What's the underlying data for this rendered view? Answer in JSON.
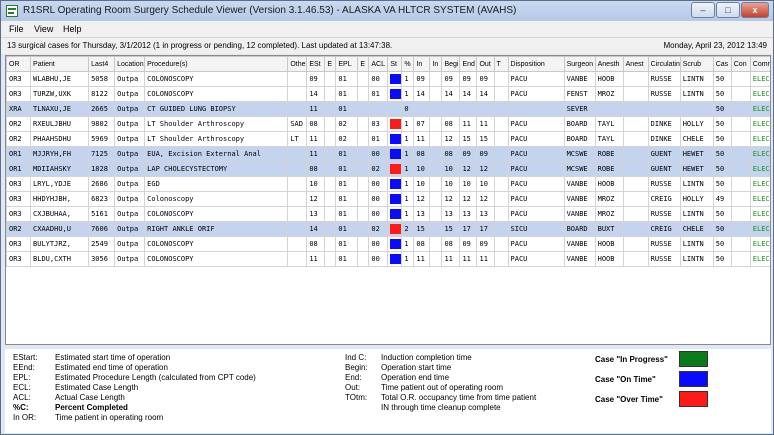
{
  "window": {
    "title": "R1SRL Operating Room Surgery Schedule Viewer (Version 3.1.46.53) - ALASKA VA HLTCR SYSTEM (AVAHS)",
    "minimize": "–",
    "maximize": "□",
    "close": "x"
  },
  "menu": [
    "File",
    "View",
    "Help"
  ],
  "status": {
    "summary": "13 surgical cases for Thursday, 3/1/2012 (1 in progress or pending, 12 completed).  Last updated at 13:47:38.",
    "datetime": "Monday, April 23, 2012 13:49"
  },
  "columns": [
    "OR",
    "Patient",
    "Last4",
    "Location",
    "Procedure(s)",
    "Othe",
    "ESt",
    "E",
    "EPL",
    "E",
    "ACL",
    "St",
    "%",
    "In",
    "In",
    "Begi",
    "End",
    "Out",
    "T",
    "Disposition",
    "Surgeon",
    "Anesth",
    "Anest",
    "Circulatin",
    "Scrub",
    "Cas",
    "Con",
    "Comm"
  ],
  "rows": [
    {
      "hl": false,
      "cells": [
        "OR3",
        "WLABHU,JE",
        "5058",
        "Outpa",
        "COLONOSCOPY",
        "",
        "09",
        "",
        "01",
        "",
        "00",
        "",
        "1",
        "09",
        "",
        "09",
        "09",
        "09",
        "",
        "PACU",
        "VANBE",
        "HOOB",
        "",
        "RUSSE",
        "LINTN",
        "50",
        "",
        "ELEC"
      ],
      "status": "blue"
    },
    {
      "hl": false,
      "cells": [
        "OR3",
        "TURZW,UXK",
        "8122",
        "Outpa",
        "COLONOSCOPY",
        "",
        "14",
        "",
        "01",
        "",
        "01",
        "",
        "1",
        "14",
        "",
        "14",
        "14",
        "14",
        "",
        "PACU",
        "FENST",
        "MROZ",
        "",
        "RUSSE",
        "LINTN",
        "50",
        "",
        "ELEC"
      ],
      "status": "blue"
    },
    {
      "hl": true,
      "cells": [
        "XRA",
        "TLNAXU,JE",
        "2665",
        "Outpa",
        "CT GUIDED LUNG BIOPSY",
        "",
        "11",
        "",
        "01",
        "",
        "",
        "",
        "0",
        "",
        "",
        "",
        "",
        "",
        "",
        "",
        "SEVER",
        "",
        "",
        "",
        "",
        "50",
        "",
        "ELEC"
      ],
      "status": "none"
    },
    {
      "hl": false,
      "cells": [
        "OR2",
        "RXEULJBHU",
        "9802",
        "Outpa",
        "LT Shoulder Arthroscopy",
        "SAD",
        "08",
        "",
        "02",
        "",
        "03",
        "",
        "1",
        "07",
        "",
        "08",
        "11",
        "11",
        "",
        "PACU",
        "BOARD",
        "TAYL",
        "",
        "DINKE",
        "HOLLY",
        "50",
        "",
        "ELEC"
      ],
      "status": "red"
    },
    {
      "hl": false,
      "cells": [
        "OR2",
        "PHAAHSDHU",
        "5969",
        "Outpa",
        "LT Shoulder Arthroscopy",
        "LT",
        "11",
        "",
        "02",
        "",
        "01",
        "",
        "1",
        "11",
        "",
        "12",
        "15",
        "15",
        "",
        "PACU",
        "BOARD",
        "TAYL",
        "",
        "DINKE",
        "CHELE",
        "50",
        "",
        "ELEC"
      ],
      "status": "blue"
    },
    {
      "hl": true,
      "cells": [
        "OR1",
        "MJJRYH,FH",
        "7125",
        "Outpa",
        "EUA, Excision External Anal",
        "",
        "11",
        "",
        "01",
        "",
        "00",
        "",
        "1",
        "08",
        "",
        "08",
        "09",
        "09",
        "",
        "PACU",
        "MCSWE",
        "ROBE",
        "",
        "GUENT",
        "HEWET",
        "50",
        "",
        "ELEC"
      ],
      "status": "blue"
    },
    {
      "hl": true,
      "cells": [
        "OR1",
        "MDIIAHSKY",
        "1828",
        "Outpa",
        "LAP CHOLECYSTECTOMY",
        "",
        "08",
        "",
        "01",
        "",
        "02",
        "",
        "1",
        "10",
        "",
        "10",
        "12",
        "12",
        "",
        "PACU",
        "MCSWE",
        "ROBE",
        "",
        "GUENT",
        "HEWET",
        "50",
        "",
        "ELEC"
      ],
      "status": "red"
    },
    {
      "hl": false,
      "cells": [
        "OR3",
        "LRYL,YDJE",
        "2686",
        "Outpa",
        "EGD",
        "",
        "10",
        "",
        "01",
        "",
        "00",
        "",
        "1",
        "10",
        "",
        "10",
        "10",
        "10",
        "",
        "PACU",
        "VANBE",
        "HOOB",
        "",
        "RUSSE",
        "LINTN",
        "50",
        "",
        "ELEC"
      ],
      "status": "blue"
    },
    {
      "hl": false,
      "cells": [
        "OR3",
        "HHDYHJBH,",
        "6823",
        "Outpa",
        "Colonoscopy",
        "",
        "12",
        "",
        "01",
        "",
        "00",
        "",
        "1",
        "12",
        "",
        "12",
        "12",
        "12",
        "",
        "PACU",
        "VANBE",
        "MROZ",
        "",
        "CREIG",
        "HOLLY",
        "49",
        "",
        "ELEC"
      ],
      "status": "blue"
    },
    {
      "hl": false,
      "cells": [
        "OR3",
        "CXJBUHAA,",
        "5161",
        "Outpa",
        "COLONOSCOPY",
        "",
        "13",
        "",
        "01",
        "",
        "00",
        "",
        "1",
        "13",
        "",
        "13",
        "13",
        "13",
        "",
        "PACU",
        "VANBE",
        "MROZ",
        "",
        "RUSSE",
        "LINTN",
        "50",
        "",
        "ELEC"
      ],
      "status": "blue"
    },
    {
      "hl": true,
      "cells": [
        "OR2",
        "CXAADHU,U",
        "7606",
        "Outpa",
        "RIGHT ANKLE ORIF",
        "",
        "14",
        "",
        "01",
        "",
        "02",
        "",
        "2",
        "15",
        "",
        "15",
        "17",
        "17",
        "",
        "SICU",
        "BOARD",
        "BUXT",
        "",
        "CREIG",
        "CHELE",
        "50",
        "",
        "ELEC"
      ],
      "status": "red"
    },
    {
      "hl": false,
      "cells": [
        "OR3",
        "BULYTJRZ,",
        "2549",
        "Outpa",
        "COLONOSCOPY",
        "",
        "08",
        "",
        "01",
        "",
        "00",
        "",
        "1",
        "08",
        "",
        "08",
        "09",
        "09",
        "",
        "PACU",
        "VANBE",
        "HOOB",
        "",
        "RUSSE",
        "LINTN",
        "50",
        "",
        "ELEC"
      ],
      "status": "blue"
    },
    {
      "hl": false,
      "cells": [
        "OR3",
        "BLDU,CXTH",
        "3056",
        "Outpa",
        "COLONOSCOPY",
        "",
        "11",
        "",
        "01",
        "",
        "00",
        "",
        "1",
        "11",
        "",
        "11",
        "11",
        "11",
        "",
        "PACU",
        "VANBE",
        "HOOB",
        "",
        "RUSSE",
        "LINTN",
        "50",
        "",
        "ELEC"
      ],
      "status": "blue"
    }
  ],
  "legend": {
    "left": [
      {
        "k": "EStart:",
        "v": "Estimated start time of operation"
      },
      {
        "k": "EEnd:",
        "v": "Estimated end time of operation"
      },
      {
        "k": "EPL:",
        "v": "Estimated Procedure Length (calculated from CPT code)"
      },
      {
        "k": "ECL:",
        "v": "Estimated Case Length"
      },
      {
        "k": "ACL:",
        "v": "Actual Case Length"
      },
      {
        "k": "%C:",
        "v": "Percent Completed"
      },
      {
        "k": "In OR:",
        "v": "Time patient in operating room"
      }
    ],
    "mid": [
      {
        "k": "Ind C:",
        "v": "Induction completion time"
      },
      {
        "k": "Begin:",
        "v": "Operation start time"
      },
      {
        "k": "End:",
        "v": "Operation end time"
      },
      {
        "k": "Out:",
        "v": "Time patient out of operating room"
      },
      {
        "k": "TOtm:",
        "v": "Total O.R. occupancy time from time patient"
      },
      {
        "k": "",
        "v": "IN through time cleanup complete"
      }
    ],
    "cases": [
      {
        "label": "Case \"In Progress\"",
        "color": "#0a7a1a"
      },
      {
        "label": "Case \"On Time\"",
        "color": "#0a0aff"
      },
      {
        "label": "Case \"Over Time\"",
        "color": "#ff1a1a"
      }
    ]
  },
  "colors": {
    "blue": "#0a0aff",
    "red": "#ff1a1a",
    "green": "#0a7a1a",
    "elec": "#1b8f1b",
    "highlight": "#c4d4ee"
  }
}
